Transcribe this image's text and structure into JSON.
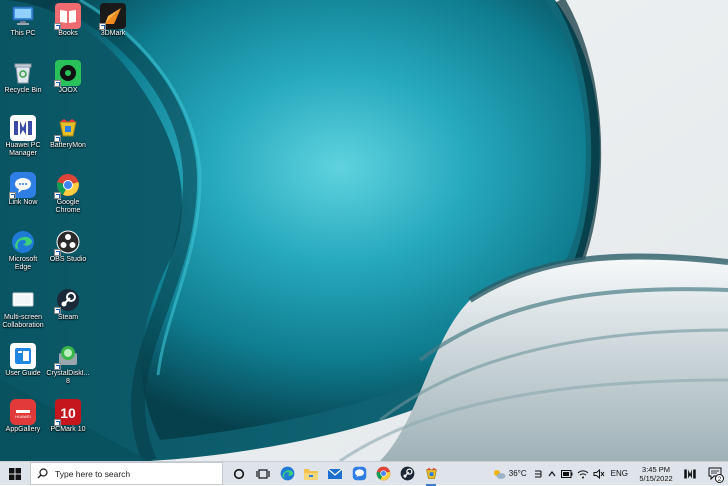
{
  "desktop": {
    "icons": [
      {
        "label": "This PC",
        "icon": "this-pc-icon"
      },
      {
        "label": "Books",
        "icon": "books-icon"
      },
      {
        "label": "3DMark",
        "icon": "3dmark-icon"
      },
      {
        "label": "Recycle Bin",
        "icon": "recycle-bin-icon"
      },
      {
        "label": "JOOX",
        "icon": "joox-icon"
      },
      {
        "label": "Huawei PC Manager",
        "icon": "huawei-pc-manager-icon"
      },
      {
        "label": "BatteryMon",
        "icon": "batterymon-icon"
      },
      {
        "label": "Link Now",
        "icon": "link-now-icon"
      },
      {
        "label": "Google Chrome",
        "icon": "chrome-icon"
      },
      {
        "label": "Microsoft Edge",
        "icon": "edge-icon"
      },
      {
        "label": "OBS Studio",
        "icon": "obs-icon"
      },
      {
        "label": "Multi-screen Collaboration",
        "icon": "multi-screen-icon"
      },
      {
        "label": "Steam",
        "icon": "steam-icon"
      },
      {
        "label": "User Guide",
        "icon": "user-guide-icon"
      },
      {
        "label": "CrystalDiskI... 8",
        "icon": "crystaldisk-icon"
      },
      {
        "label": "AppGallery",
        "icon": "appgallery-icon"
      },
      {
        "label": "PCMark 10",
        "icon": "pcmark-icon"
      }
    ]
  },
  "taskbar": {
    "search_placeholder": "Type here to search",
    "pinned": [
      "cortana-icon",
      "task-view-icon",
      "edge-icon",
      "file-explorer-icon",
      "mail-icon",
      "link-now-icon",
      "chrome-icon",
      "steam-icon",
      "batterymon-icon"
    ],
    "weather": "36°C",
    "language": "ENG",
    "time": "3:45 PM",
    "date": "5/15/2022",
    "notification_count": "2"
  },
  "colors": {
    "wallpaper_teal": "#1aa3b5",
    "wallpaper_dark": "#0a4f5c",
    "taskbar_bg": "#dfe4ea",
    "accent_blue": "#3d7cc9"
  }
}
